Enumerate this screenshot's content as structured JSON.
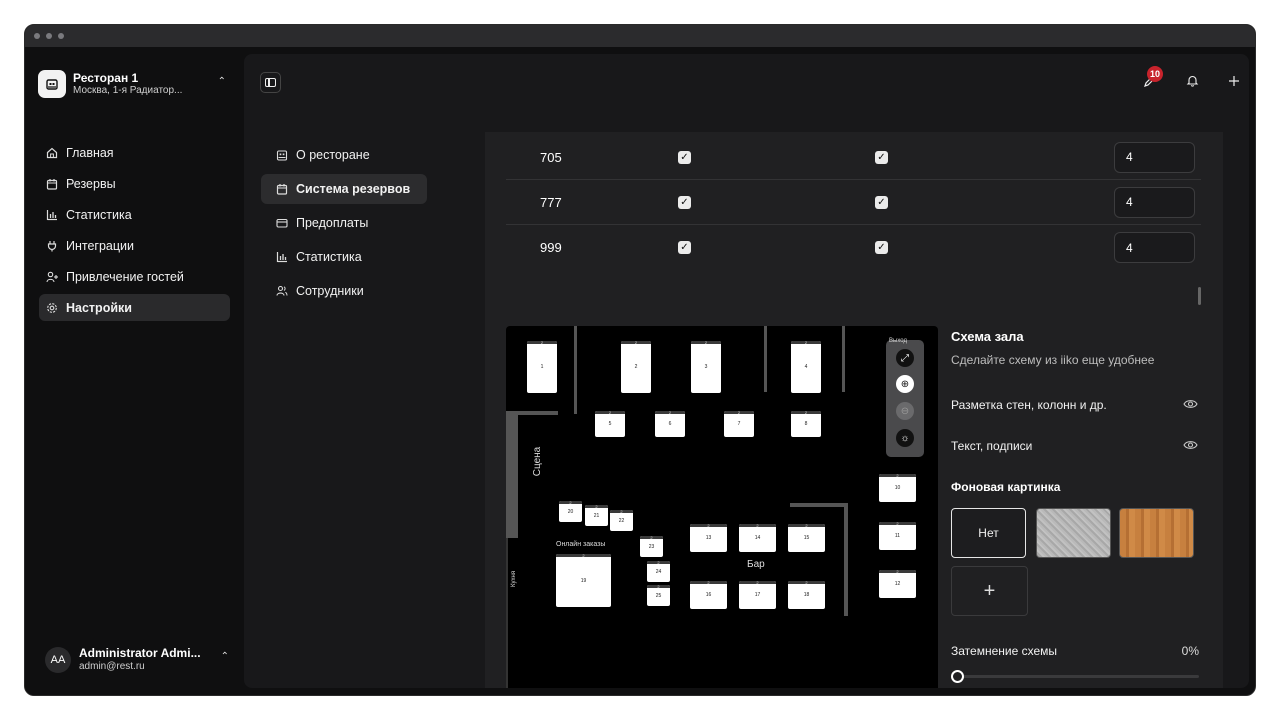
{
  "restaurant": {
    "name": "Ресторан 1",
    "address": "Москва, 1-я Радиатор..."
  },
  "sidebar": {
    "items": [
      {
        "label": "Главная",
        "icon": "home-icon"
      },
      {
        "label": "Резервы",
        "icon": "calendar-icon"
      },
      {
        "label": "Статистика",
        "icon": "bar-chart-icon"
      },
      {
        "label": "Интеграции",
        "icon": "plug-icon"
      },
      {
        "label": "Привлечение гостей",
        "icon": "user-plus-icon"
      },
      {
        "label": "Настройки",
        "icon": "gear-icon",
        "active": true
      }
    ]
  },
  "user": {
    "initials": "AA",
    "name": "Administrator Admi...",
    "email": "admin@rest.ru"
  },
  "header": {
    "notification_count": "10"
  },
  "settings_nav": {
    "items": [
      {
        "label": "О ресторане",
        "icon": "building-icon"
      },
      {
        "label": "Система резервов",
        "icon": "calendar-icon",
        "active": true
      },
      {
        "label": "Предоплаты",
        "icon": "card-icon"
      },
      {
        "label": "Статистика",
        "icon": "bar-chart-icon"
      },
      {
        "label": "Сотрудники",
        "icon": "users-icon"
      }
    ]
  },
  "table_rows": [
    {
      "number": "705",
      "check1": true,
      "check2": true,
      "value": "4"
    },
    {
      "number": "777",
      "check1": true,
      "check2": true,
      "value": "4"
    },
    {
      "number": "999",
      "check1": true,
      "check2": true,
      "value": "4"
    }
  ],
  "floor_map": {
    "labels": {
      "stage": "Сцена",
      "kitchen": "Кухня",
      "online": "Онлайн заказы",
      "bar": "Бар",
      "exit": "Выход"
    },
    "tables": [
      "1",
      "2",
      "3",
      "4",
      "5",
      "6",
      "7",
      "8",
      "10",
      "11",
      "12",
      "13",
      "14",
      "15",
      "16",
      "17",
      "18",
      "19",
      "20",
      "21",
      "22",
      "23",
      "24",
      "25"
    ],
    "table_captions": [
      "2",
      "2",
      "2",
      "2",
      "2",
      "2",
      "2",
      "2",
      "2",
      "2",
      "2",
      "2",
      "2",
      "2",
      "2",
      "2",
      "2",
      "2",
      "2",
      "2",
      "2",
      "2",
      "2",
      "2"
    ]
  },
  "scheme": {
    "title": "Схема зала",
    "subtitle": "Сделайте схему из iiko еще удобнее",
    "option_walls": "Разметка стен, колонн и др.",
    "option_text": "Текст, подписи",
    "background_title": "Фоновая картинка",
    "background_none": "Нет",
    "add_label": "+",
    "dimming_label": "Затемнение схемы",
    "dimming_value": "0%",
    "dimming_fraction": 0
  }
}
